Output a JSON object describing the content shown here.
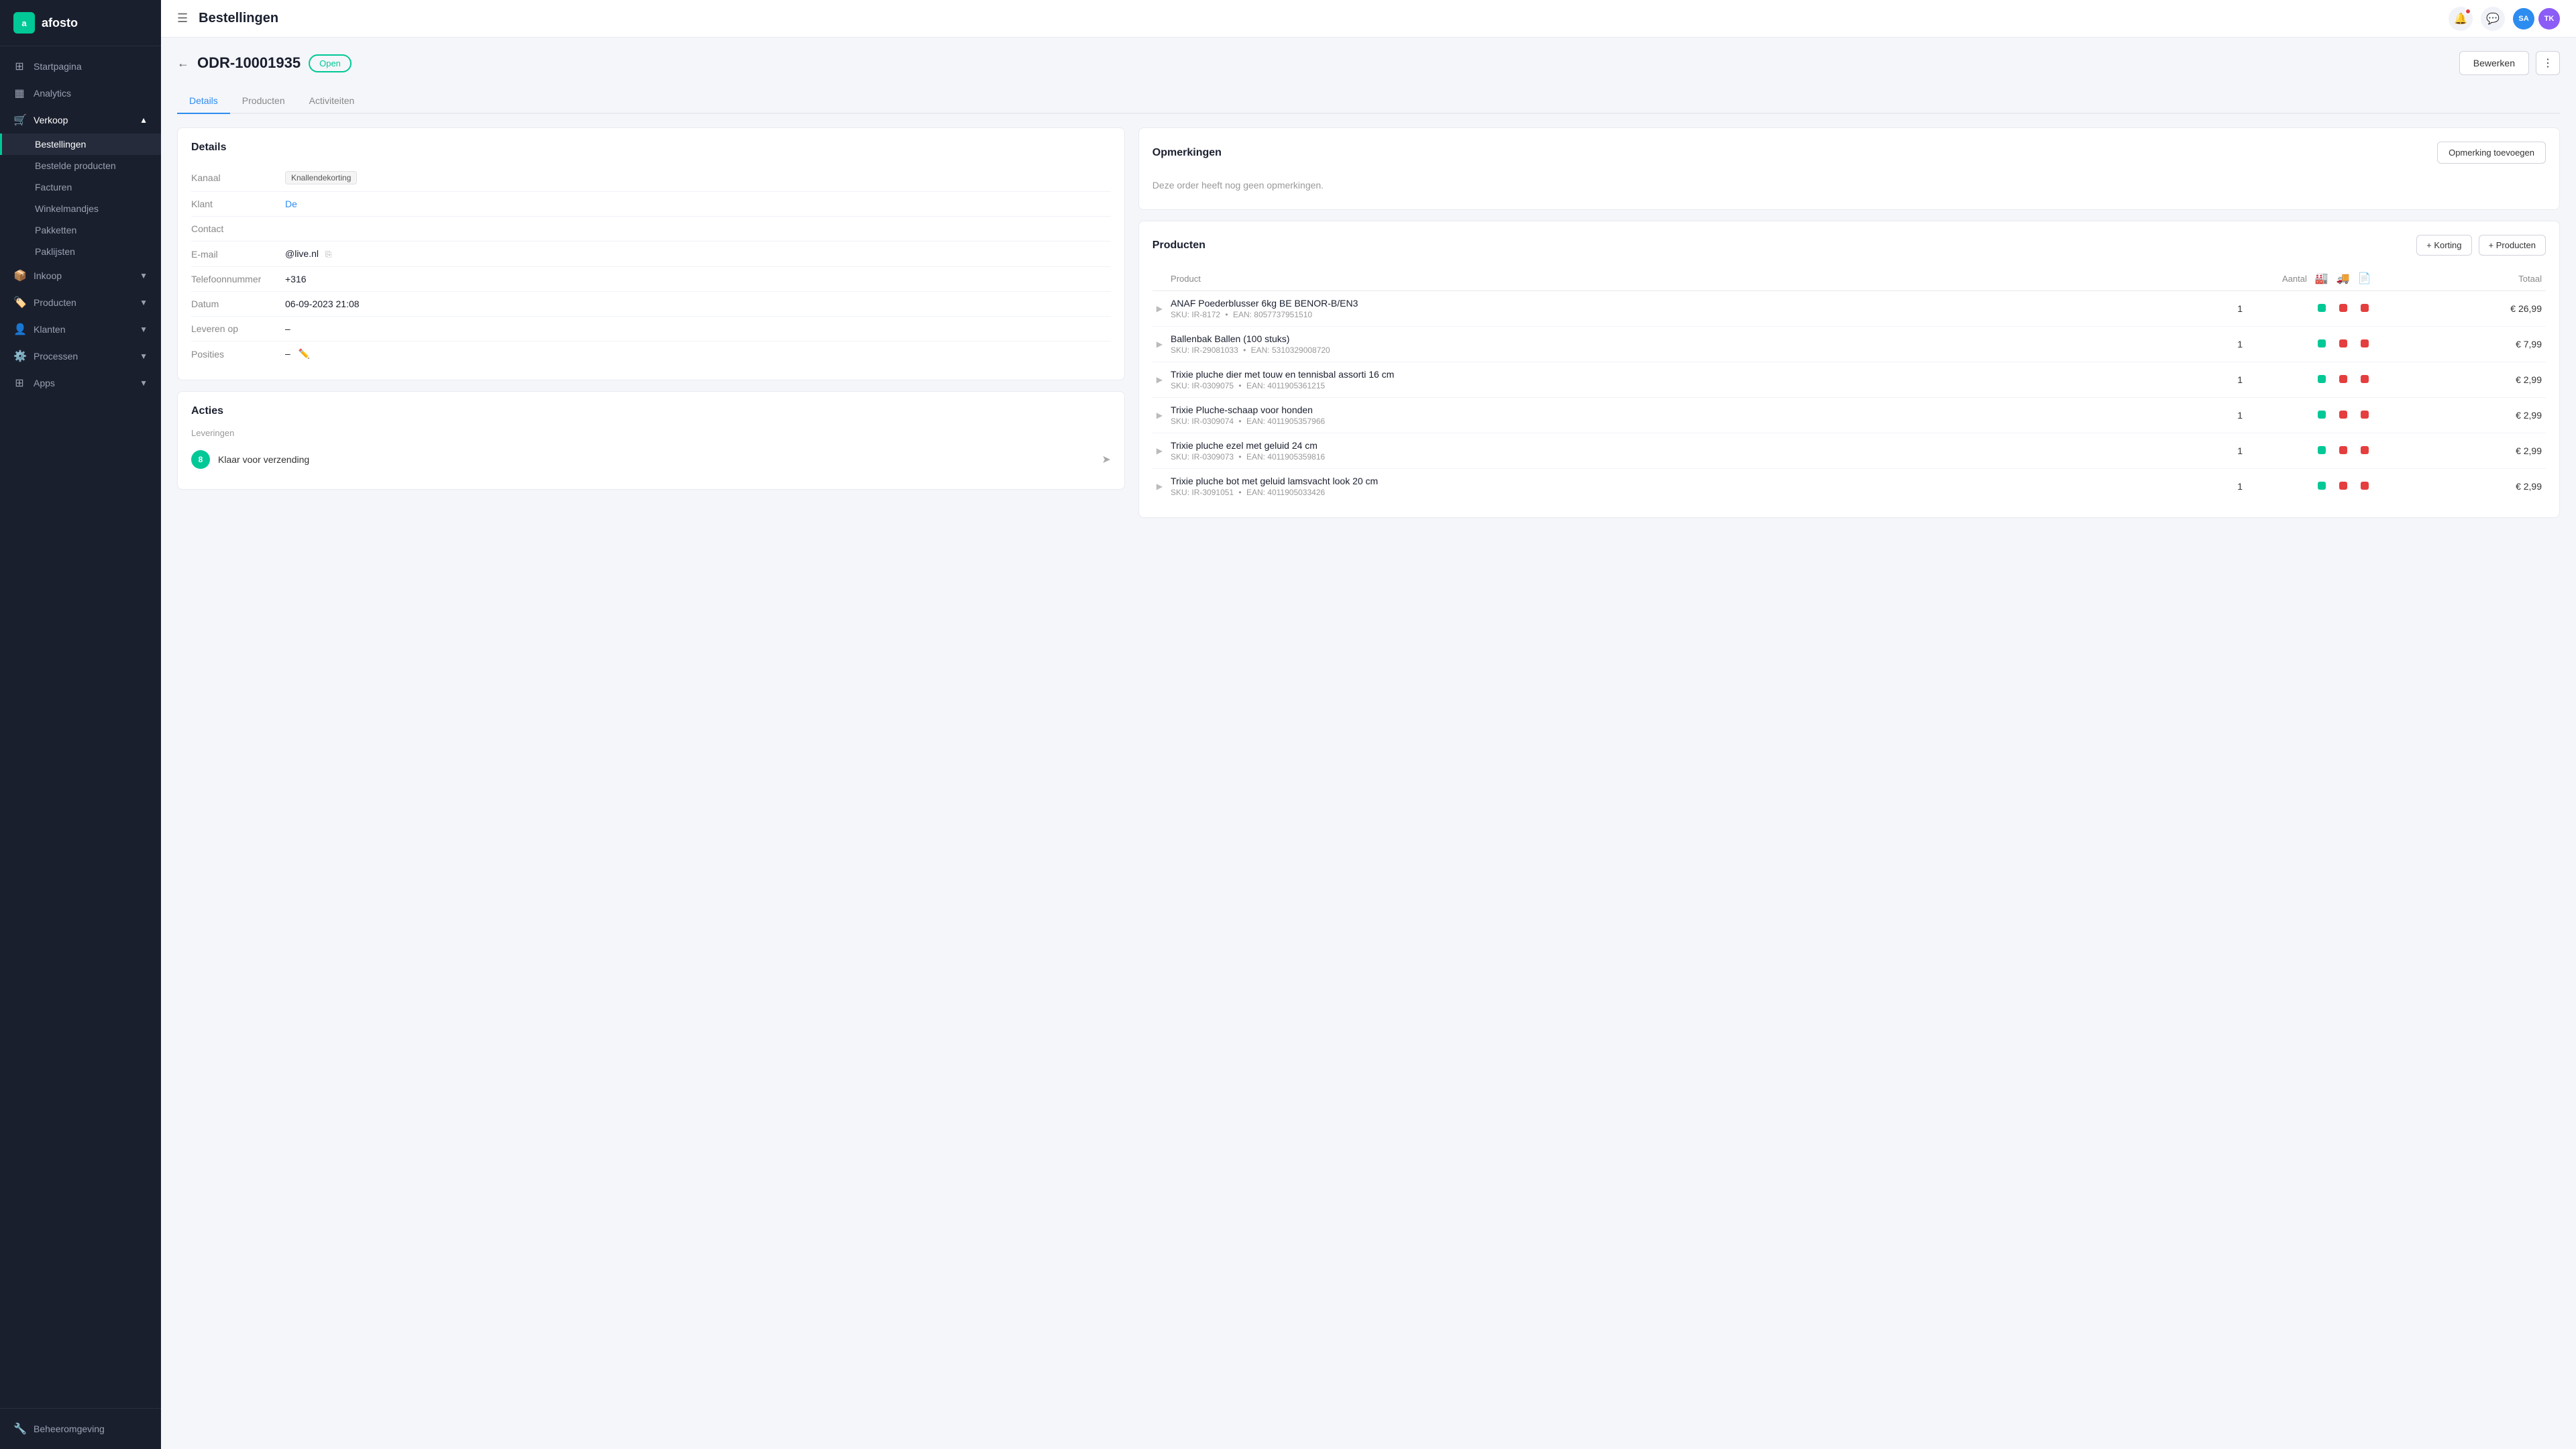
{
  "sidebar": {
    "logo": "afosto",
    "logo_letter": "a",
    "nav_items": [
      {
        "id": "startpagina",
        "label": "Startpagina",
        "icon": "⊞",
        "type": "link"
      },
      {
        "id": "analytics",
        "label": "Analytics",
        "icon": "📊",
        "type": "link"
      },
      {
        "id": "verkoop",
        "label": "Verkoop",
        "icon": "🛒",
        "type": "parent",
        "expanded": true
      },
      {
        "id": "bestellingen",
        "label": "Bestellingen",
        "type": "sub",
        "active": true
      },
      {
        "id": "bestelde-producten",
        "label": "Bestelde producten",
        "type": "sub"
      },
      {
        "id": "facturen",
        "label": "Facturen",
        "type": "sub"
      },
      {
        "id": "winkelmandjes",
        "label": "Winkelmandjes",
        "type": "sub"
      },
      {
        "id": "pakketten",
        "label": "Pakketten",
        "type": "sub"
      },
      {
        "id": "paklijsten",
        "label": "Paklijsten",
        "type": "sub"
      },
      {
        "id": "inkoop",
        "label": "Inkoop",
        "icon": "📦",
        "type": "parent"
      },
      {
        "id": "producten",
        "label": "Producten",
        "icon": "🏷️",
        "type": "parent"
      },
      {
        "id": "klanten",
        "label": "Klanten",
        "icon": "👤",
        "type": "parent"
      },
      {
        "id": "processen",
        "label": "Processen",
        "icon": "⚙️",
        "type": "parent"
      },
      {
        "id": "apps",
        "label": "Apps",
        "icon": "⊞",
        "type": "parent"
      },
      {
        "id": "beheeromgeving",
        "label": "Beheeromgeving",
        "icon": "🔧",
        "type": "bottom"
      }
    ]
  },
  "topbar": {
    "title": "Bestellingen",
    "notifications_badge": true,
    "avatar1": "SA",
    "avatar2": "TK"
  },
  "page_header": {
    "order_id": "ODR-10001935",
    "status": "Open",
    "btn_edit": "Bewerken"
  },
  "tabs": [
    {
      "id": "details",
      "label": "Details",
      "active": true
    },
    {
      "id": "producten",
      "label": "Producten",
      "active": false
    },
    {
      "id": "activiteiten",
      "label": "Activiteiten",
      "active": false
    }
  ],
  "details_card": {
    "title": "Details",
    "rows": [
      {
        "label": "Kanaal",
        "value": "Knallendekorting",
        "type": "badge"
      },
      {
        "label": "Klant",
        "value": "De",
        "type": "link"
      },
      {
        "label": "Contact",
        "value": "",
        "type": "text"
      },
      {
        "label": "E-mail",
        "value": "@live.nl",
        "type": "copy"
      },
      {
        "label": "Telefoonnummer",
        "value": "+316",
        "type": "text"
      },
      {
        "label": "Datum",
        "value": "06-09-2023 21:08",
        "type": "text"
      },
      {
        "label": "Leveren op",
        "value": "–",
        "type": "text"
      },
      {
        "label": "Posities",
        "value": "–",
        "type": "edit"
      }
    ]
  },
  "acties_card": {
    "title": "Acties",
    "leveringen_title": "Leveringen",
    "delivery_count": "8",
    "delivery_label": "Klaar voor verzending"
  },
  "opmerkingen_card": {
    "title": "Opmerkingen",
    "btn_add": "Opmerking toevoegen",
    "empty_text": "Deze order heeft nog geen opmerkingen."
  },
  "producten_card": {
    "title": "Producten",
    "btn_korting": "+ Korting",
    "btn_producten": "+ Producten",
    "columns": {
      "product": "Product",
      "aantal": "Aantal",
      "totaal": "Totaal"
    },
    "products": [
      {
        "name": "ANAF Poederblusser 6kg BE BENOR-B/EN3",
        "sku": "IR-8172",
        "ean": "8057737951510",
        "qty": 1,
        "status_green": true,
        "status_red1": true,
        "status_red2": true,
        "total": "€ 26,99"
      },
      {
        "name": "Ballenbak Ballen (100 stuks)",
        "sku": "IR-29081033",
        "ean": "5310329008720",
        "qty": 1,
        "status_green": true,
        "status_red1": true,
        "status_red2": true,
        "total": "€ 7,99"
      },
      {
        "name": "Trixie pluche dier met touw en tennisbal assorti 16 cm",
        "sku": "IR-0309075",
        "ean": "4011905361215",
        "qty": 1,
        "status_green": true,
        "status_red1": true,
        "status_red2": true,
        "total": "€ 2,99"
      },
      {
        "name": "Trixie Pluche-schaap voor honden",
        "sku": "IR-0309074",
        "ean": "4011905357966",
        "qty": 1,
        "status_green": true,
        "status_red1": true,
        "status_red2": true,
        "total": "€ 2,99"
      },
      {
        "name": "Trixie pluche ezel met geluid 24 cm",
        "sku": "IR-0309073",
        "ean": "4011905359816",
        "qty": 1,
        "status_green": true,
        "status_red1": true,
        "status_red2": true,
        "total": "€ 2,99"
      },
      {
        "name": "Trixie pluche bot met geluid lamsvacht look 20 cm",
        "sku": "IR-3091051",
        "ean": "4011905033426",
        "qty": 1,
        "status_green": true,
        "status_red1": true,
        "status_red2": true,
        "total": "€ 2,99"
      }
    ]
  }
}
